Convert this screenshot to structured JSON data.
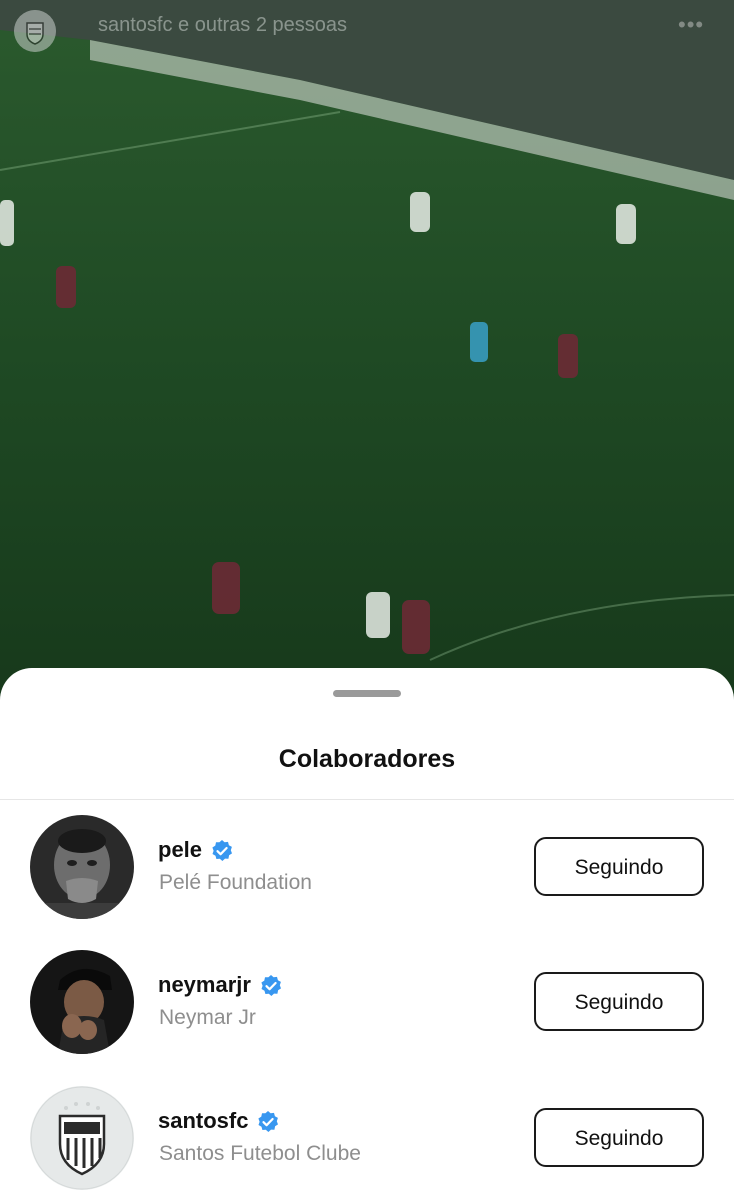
{
  "story": {
    "title": "santosfc e outras 2 pessoas",
    "more_icon": "more-horizontal-icon",
    "avatar_icon": "santos-crest-icon"
  },
  "sheet": {
    "title": "Colaboradores"
  },
  "collaborators": [
    {
      "username": "pele",
      "full_name": "Pelé Foundation",
      "button": "Seguindo",
      "verified": true
    },
    {
      "username": "neymarjr",
      "full_name": "Neymar Jr",
      "button": "Seguindo",
      "verified": true
    },
    {
      "username": "santosfc",
      "full_name": "Santos Futebol Clube",
      "button": "Seguindo",
      "verified": true
    }
  ],
  "colors": {
    "verified": "#3897f0",
    "pitch": "#1f4a24"
  }
}
